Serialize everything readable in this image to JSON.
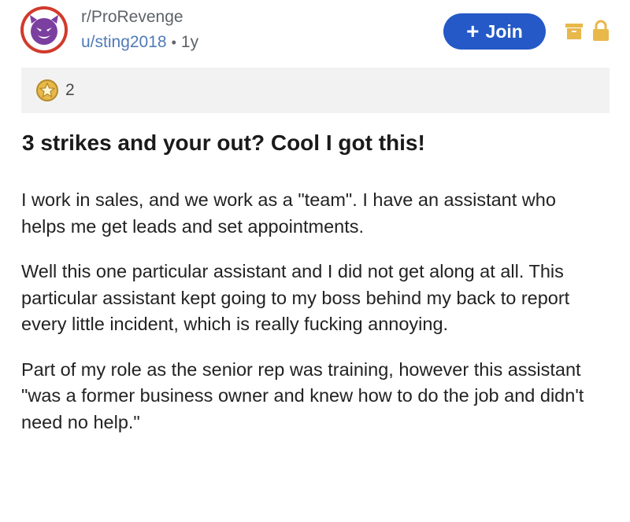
{
  "post": {
    "subreddit": "r/ProRevenge",
    "author": "u/sting2018",
    "separator": "•",
    "age": "1y",
    "join_label": "Join",
    "join_plus": "+",
    "awards_count": "2",
    "title": "3 strikes and your out? Cool I got this!",
    "paragraphs": [
      "I work in sales, and we work as a \"team\". I have an assistant who helps me get leads and set appointments.",
      "Well this one particular assistant and I did not get along at all. This particular assistant kept going to my boss behind my back to report every little incident, which is really fucking annoying.",
      "Part of my role as the senior rep was training, however this assistant \"was a former business owner and knew how to do the job and didn't need no help.\""
    ]
  },
  "icons": {
    "avatar": "devil-face-icon",
    "archive": "archive-icon",
    "lock": "lock-icon",
    "award": "award-star-icon"
  },
  "colors": {
    "join_button": "#2459c7",
    "username": "#4f7bb7",
    "avatar_ring": "#d23a2c",
    "avatar_face": "#7b3fa0",
    "icon_gold": "#e8b84a"
  }
}
